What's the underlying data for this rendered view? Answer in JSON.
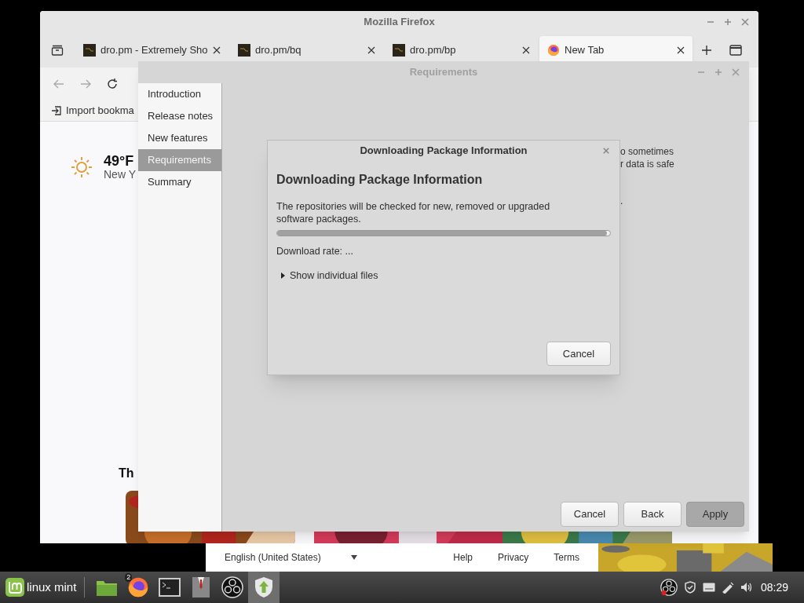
{
  "firefox": {
    "title": "Mozilla Firefox",
    "tabs": [
      {
        "label": "dro.pm - Extremely Sho",
        "kind": "site",
        "selected": false
      },
      {
        "label": "dro.pm/bq",
        "kind": "site",
        "selected": false
      },
      {
        "label": "dro.pm/bp",
        "kind": "site",
        "selected": false
      },
      {
        "label": "New Tab",
        "kind": "firefox",
        "selected": true
      }
    ],
    "bookmark": "Import bookma",
    "weather": {
      "temperature": "49°F",
      "location": "New Y"
    },
    "notice_lines": [
      "o sometimes",
      "r data is safe",
      "."
    ],
    "section_heading": "Th"
  },
  "page_footer": {
    "language": "English (United States)",
    "links": [
      "Help",
      "Privacy",
      "Terms"
    ]
  },
  "requirements_window": {
    "title": "Requirements",
    "steps": [
      {
        "label": "Introduction",
        "selected": false
      },
      {
        "label": "Release notes",
        "selected": false
      },
      {
        "label": "New features",
        "selected": false
      },
      {
        "label": "Requirements",
        "selected": true
      },
      {
        "label": "Summary",
        "selected": false
      }
    ],
    "buttons": [
      {
        "label": "Cancel",
        "default": false
      },
      {
        "label": "Back",
        "default": false
      },
      {
        "label": "Apply",
        "default": true
      }
    ]
  },
  "dialog": {
    "title": "Downloading Package Information",
    "heading": "Downloading Package Information",
    "description": "The repositories will be checked for new, removed or upgraded software packages.",
    "progress": {
      "level": 0.99
    },
    "rate": "Download rate: ...",
    "expander": {
      "label": "Show individual files",
      "expanded": false
    },
    "button": "Cancel"
  },
  "taskbar": {
    "menu_label": "linux mint",
    "apps": [
      {
        "kind": "files",
        "active": false
      },
      {
        "kind": "firefox",
        "active": false,
        "badge": "2"
      },
      {
        "kind": "terminal",
        "active": false
      },
      {
        "kind": "suit",
        "active": false
      },
      {
        "kind": "obs",
        "active": false
      },
      {
        "kind": "update",
        "active": true
      }
    ],
    "clock": "08:29"
  }
}
